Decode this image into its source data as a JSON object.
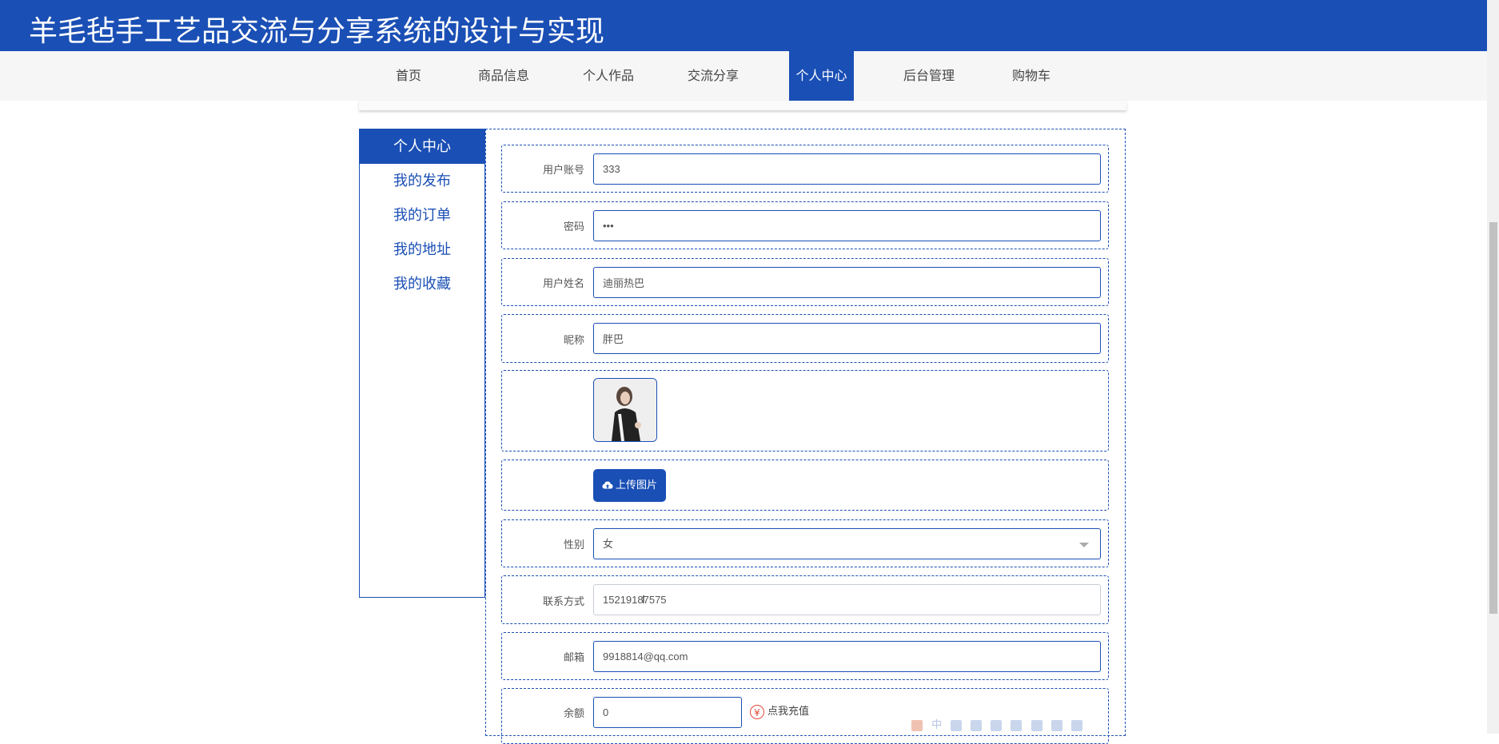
{
  "header": {
    "title": "羊毛毡手工艺品交流与分享系统的设计与实现"
  },
  "nav": {
    "items": [
      {
        "label": "首页"
      },
      {
        "label": "商品信息"
      },
      {
        "label": "个人作品"
      },
      {
        "label": "交流分享"
      },
      {
        "label": "个人中心",
        "active": true
      },
      {
        "label": "后台管理"
      },
      {
        "label": "购物车"
      }
    ]
  },
  "sidebar": {
    "items": [
      {
        "label": "个人中心",
        "active": true
      },
      {
        "label": "我的发布"
      },
      {
        "label": "我的订单"
      },
      {
        "label": "我的地址"
      },
      {
        "label": "我的收藏"
      }
    ]
  },
  "form": {
    "account": {
      "label": "用户账号",
      "value": "333"
    },
    "password": {
      "label": "密码",
      "value": "•••"
    },
    "name": {
      "label": "用户姓名",
      "value": "迪丽热巴"
    },
    "nickname": {
      "label": "昵称",
      "value": "胖巴"
    },
    "upload": {
      "label": "上传图片"
    },
    "gender": {
      "label": "性别",
      "value": "女"
    },
    "phone": {
      "label": "联系方式",
      "value": "15219187575"
    },
    "email": {
      "label": "邮箱",
      "value": "9918814@qq.com"
    },
    "balance": {
      "label": "余额",
      "value": "0",
      "recharge_label": "点我充值",
      "currency_symbol": "¥"
    }
  },
  "ime_toolbar": {
    "mode": "中"
  },
  "colors": {
    "primary": "#1a4fb5",
    "recharge_icon": "#e04a3a"
  }
}
